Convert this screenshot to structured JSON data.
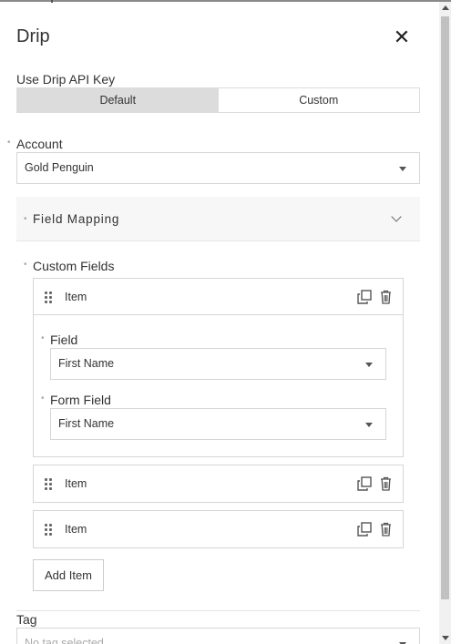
{
  "panel": {
    "title": "Drip",
    "close_icon": "close-icon"
  },
  "api_key": {
    "label": "Use Drip API Key",
    "options": [
      "Default",
      "Custom"
    ],
    "selected": "Default"
  },
  "account": {
    "label": "Account",
    "value": "Gold Penguin"
  },
  "field_mapping": {
    "title": "Field Mapping",
    "expanded": true,
    "custom_fields_label": "Custom Fields",
    "items": [
      {
        "label": "Item",
        "expanded": true,
        "field_label": "Field",
        "field_value": "First Name",
        "form_field_label": "Form Field",
        "form_field_value": "First Name"
      },
      {
        "label": "Item",
        "expanded": false
      },
      {
        "label": "Item",
        "expanded": false
      }
    ],
    "add_item_label": "Add Item"
  },
  "tag": {
    "label": "Tag",
    "placeholder": "No tag selected"
  },
  "colors": {
    "toggle_active": "#dcdcdc",
    "border": "#d6d6d6",
    "mapping_bg": "#f7f7f7"
  }
}
